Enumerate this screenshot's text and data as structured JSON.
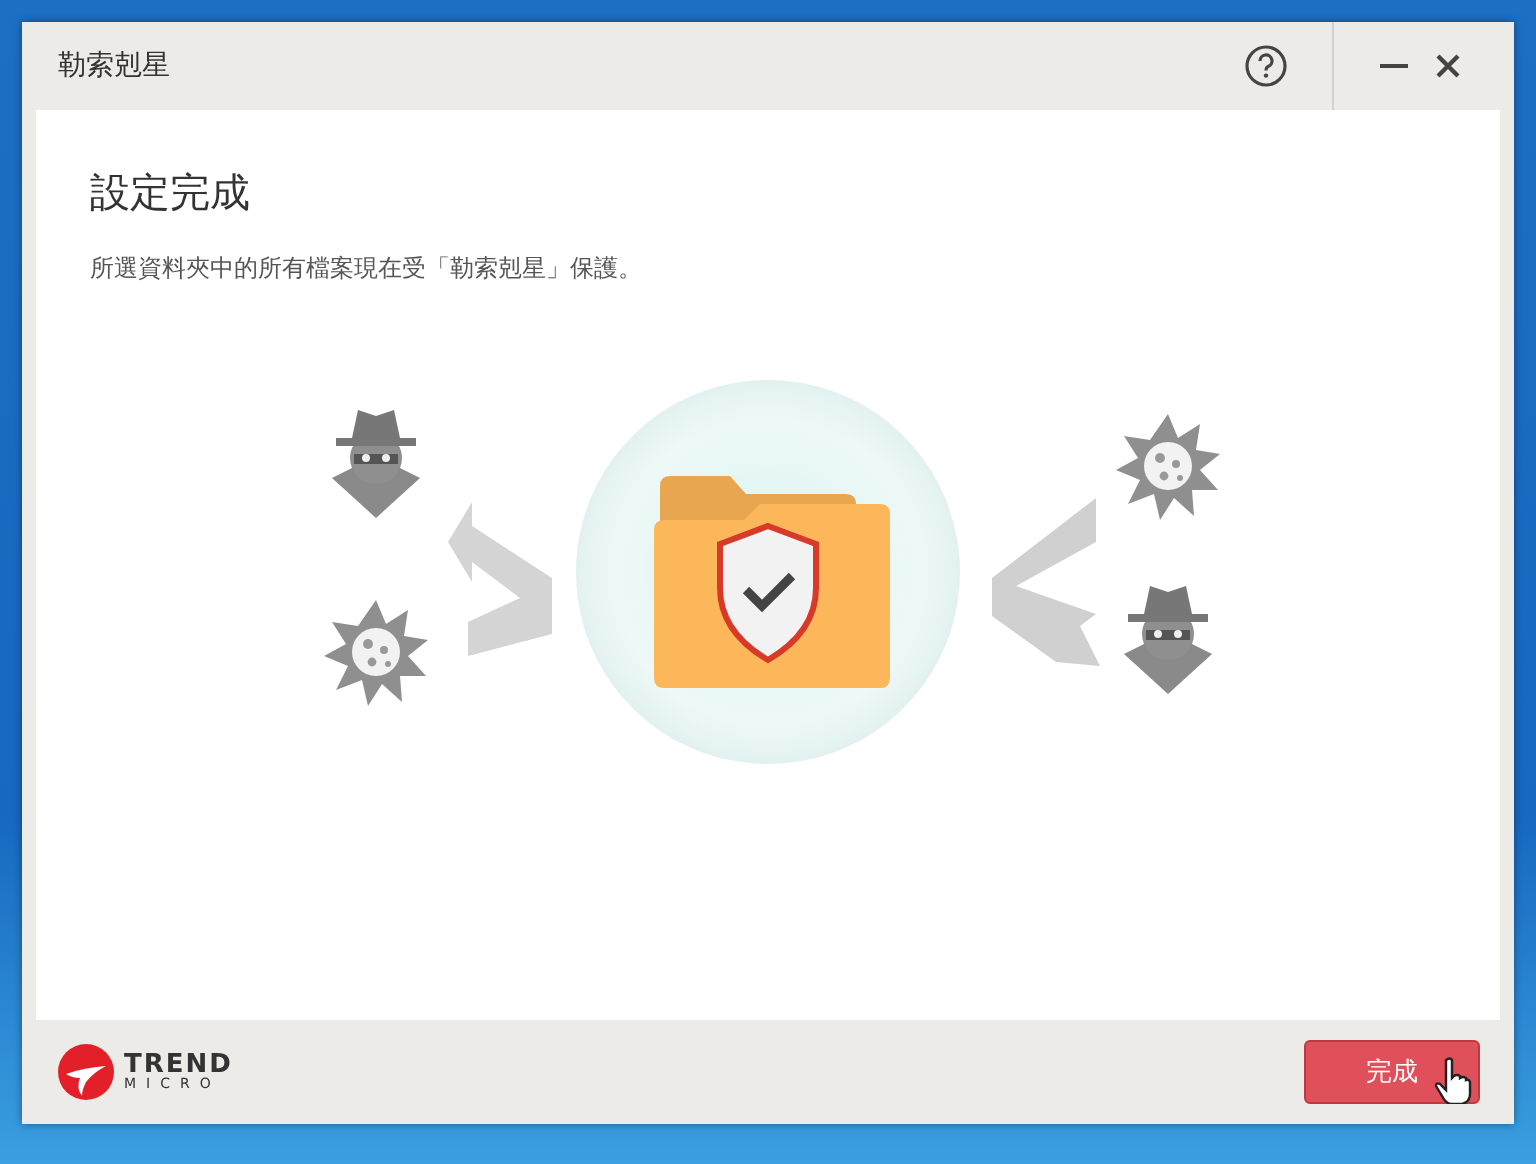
{
  "window": {
    "title": "勒索剋星"
  },
  "heading": "設定完成",
  "message": "所選資料夾中的所有檔案現在受「勒索剋星」保護。",
  "logo": {
    "word": "TREND",
    "subword": "MICRO"
  },
  "buttons": [
    {
      "label": "完成",
      "kind": "primary"
    }
  ]
}
